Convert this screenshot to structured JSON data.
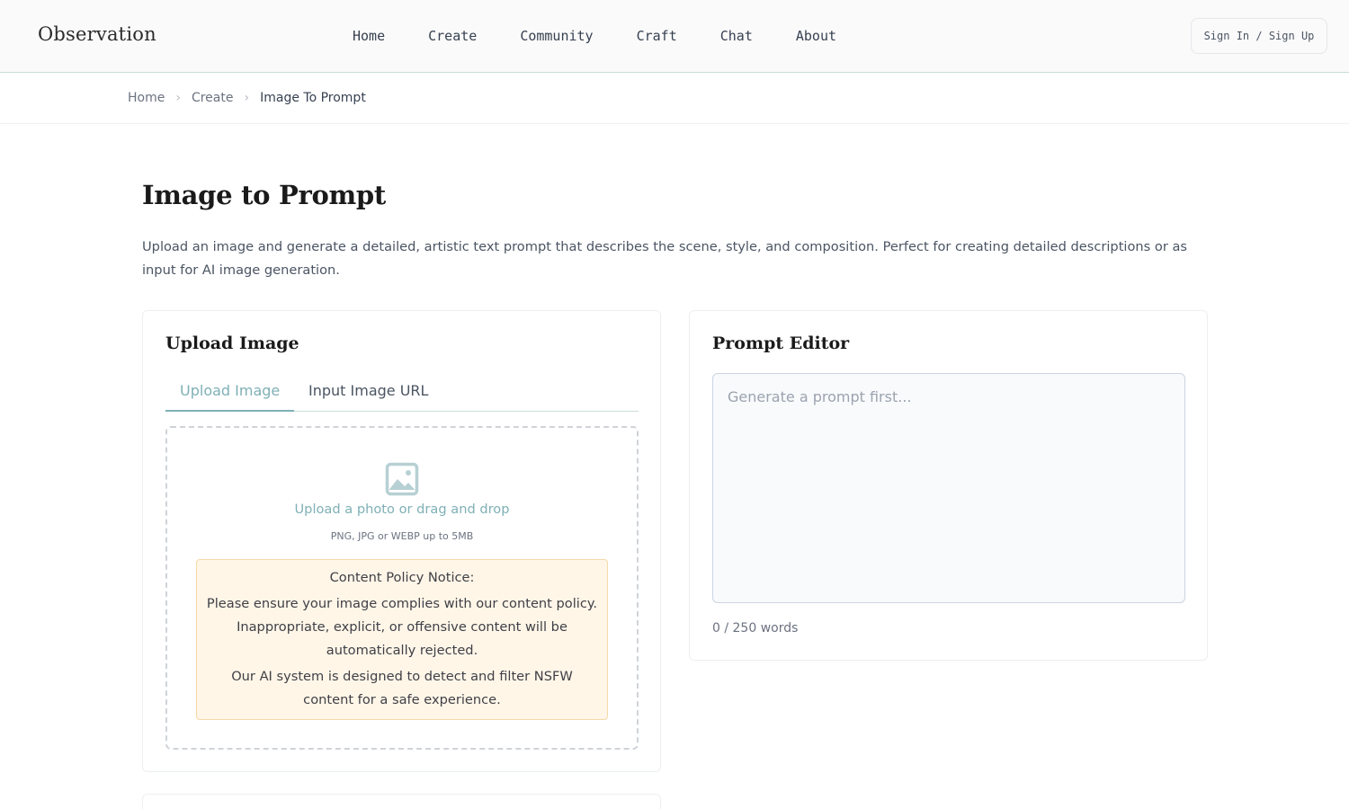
{
  "header": {
    "logo": "Observation",
    "nav": [
      "Home",
      "Create",
      "Community",
      "Craft",
      "Chat",
      "About"
    ],
    "signin_label": "Sign In / Sign Up"
  },
  "breadcrumb": {
    "items": [
      "Home",
      "Create"
    ],
    "current": "Image To Prompt"
  },
  "page": {
    "title": "Image to Prompt",
    "description": "Upload an image and generate a detailed, artistic text prompt that describes the scene, style, and composition. Perfect for creating detailed descriptions or as input for AI image generation."
  },
  "upload_card": {
    "title": "Upload Image",
    "tabs": {
      "active": "Upload Image",
      "inactive": "Input Image URL"
    },
    "dropzone": {
      "icon": "image-icon",
      "label": "Upload a photo or drag and drop",
      "hint": "PNG, JPG or WEBP up to 5MB"
    },
    "notice": {
      "title": "Content Policy Notice:",
      "body": "Please ensure your image complies with our content policy. Inappropriate, explicit, or offensive content will be automatically rejected.",
      "footer": "Our AI system is designed to detect and filter NSFW content for a safe experience."
    }
  },
  "prompt_card": {
    "title": "Prompt Editor",
    "value": "",
    "placeholder": "Generate a prompt first...",
    "word_count": "0 / 250 words"
  },
  "colors": {
    "accent": "#7fb0b6",
    "notice_bg": "#fff6e8",
    "notice_border": "#f5d9a8",
    "header_bg": "#fafafa"
  }
}
